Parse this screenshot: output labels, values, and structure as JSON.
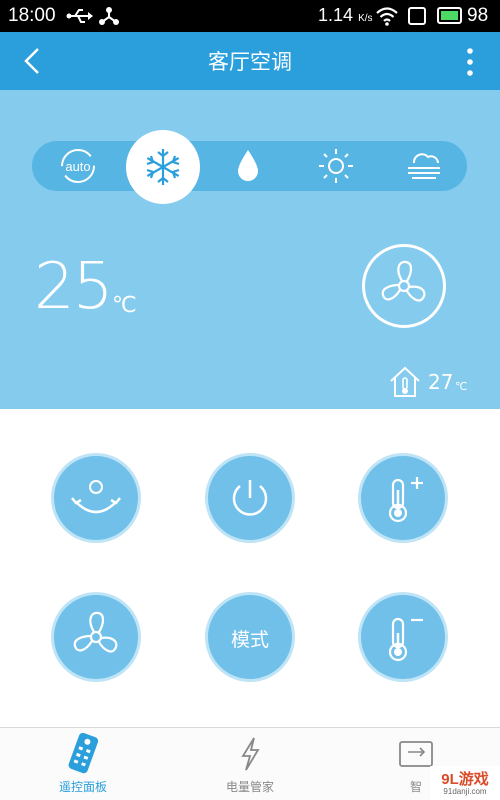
{
  "status_bar": {
    "time": "18:00",
    "speed": "1.14",
    "speed_unit": "K/s",
    "battery": "98"
  },
  "header": {
    "title": "客厅空调"
  },
  "modes": {
    "auto_label": "auto",
    "items": [
      "auto-icon",
      "snowflake-icon",
      "water-drop-icon",
      "sun-icon",
      "fog-icon"
    ],
    "selected": "snowflake-icon"
  },
  "climate": {
    "set_temperature": "25",
    "set_unit": "℃",
    "indoor_temperature": "27",
    "indoor_unit": "℃"
  },
  "controls": {
    "mode_label": "模式"
  },
  "tabs": [
    {
      "label": "遥控面板",
      "icon": "remote-icon"
    },
    {
      "label": "电量管家",
      "icon": "lightning-icon"
    },
    {
      "label": "智",
      "icon": "screen-icon"
    }
  ],
  "watermark": {
    "brand": "9L游戏",
    "site": "91danji.com"
  },
  "colors": {
    "header": "#2a9fdc",
    "panel": "#84cbed",
    "button": "#70c0ea",
    "active_tab": "#2a9fdc"
  }
}
